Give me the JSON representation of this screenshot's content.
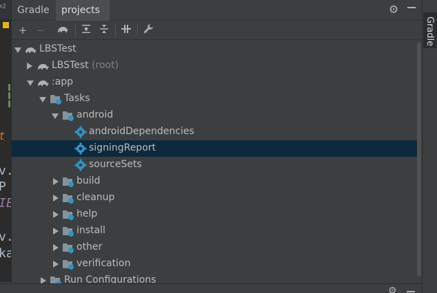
{
  "colors": {
    "panel_bg": "#3c3f41",
    "selection": "#0d293e",
    "text": "#bbbbbb",
    "gear_icon": "#3592c4",
    "elephant_icon": "#afb1b3"
  },
  "editor": {
    "badge": "≡2",
    "fragments": [
      "t",
      "v.",
      "P",
      "IE",
      "v.",
      "ka"
    ]
  },
  "panel": {
    "tool_name": "Gradle",
    "tab_label": "projects",
    "toolbar": {
      "add": "+",
      "remove": "−",
      "icons": [
        "add-icon",
        "remove-icon",
        "gradle-elephant-icon",
        "expand-all-icon",
        "collapse-all-icon",
        "toggle-offline-icon",
        "settings-wrench-icon"
      ]
    },
    "tree": [
      {
        "label": "LBSTest",
        "hint": "",
        "icon": "gradle-elephant-icon",
        "expanded": true
      },
      {
        "label": "LBSTest",
        "hint": " (root)",
        "icon": "gradle-elephant-icon",
        "expanded": false
      },
      {
        "label": ":app",
        "hint": "",
        "icon": "gradle-elephant-icon",
        "expanded": true
      },
      {
        "label": "Tasks",
        "hint": "",
        "icon": "task-folder-icon",
        "expanded": true
      },
      {
        "label": "android",
        "hint": "",
        "icon": "task-folder-icon",
        "expanded": true
      },
      {
        "label": "androidDependencies",
        "hint": "",
        "icon": "gear-task-icon"
      },
      {
        "label": "signingReport",
        "hint": "",
        "icon": "gear-task-icon",
        "selected": true
      },
      {
        "label": "sourceSets",
        "hint": "",
        "icon": "gear-task-icon"
      },
      {
        "label": "build",
        "hint": "",
        "icon": "task-folder-icon",
        "expanded": false
      },
      {
        "label": "cleanup",
        "hint": "",
        "icon": "task-folder-icon",
        "expanded": false
      },
      {
        "label": "help",
        "hint": "",
        "icon": "task-folder-icon",
        "expanded": false
      },
      {
        "label": "install",
        "hint": "",
        "icon": "task-folder-icon",
        "expanded": false
      },
      {
        "label": "other",
        "hint": "",
        "icon": "task-folder-icon",
        "expanded": false
      },
      {
        "label": "verification",
        "hint": "",
        "icon": "task-folder-icon",
        "expanded": false
      },
      {
        "label": "Run Configurations",
        "hint": "",
        "icon": "task-folder-icon",
        "expanded": false
      }
    ]
  },
  "side_stripe": {
    "tab_label": "Gradle"
  }
}
